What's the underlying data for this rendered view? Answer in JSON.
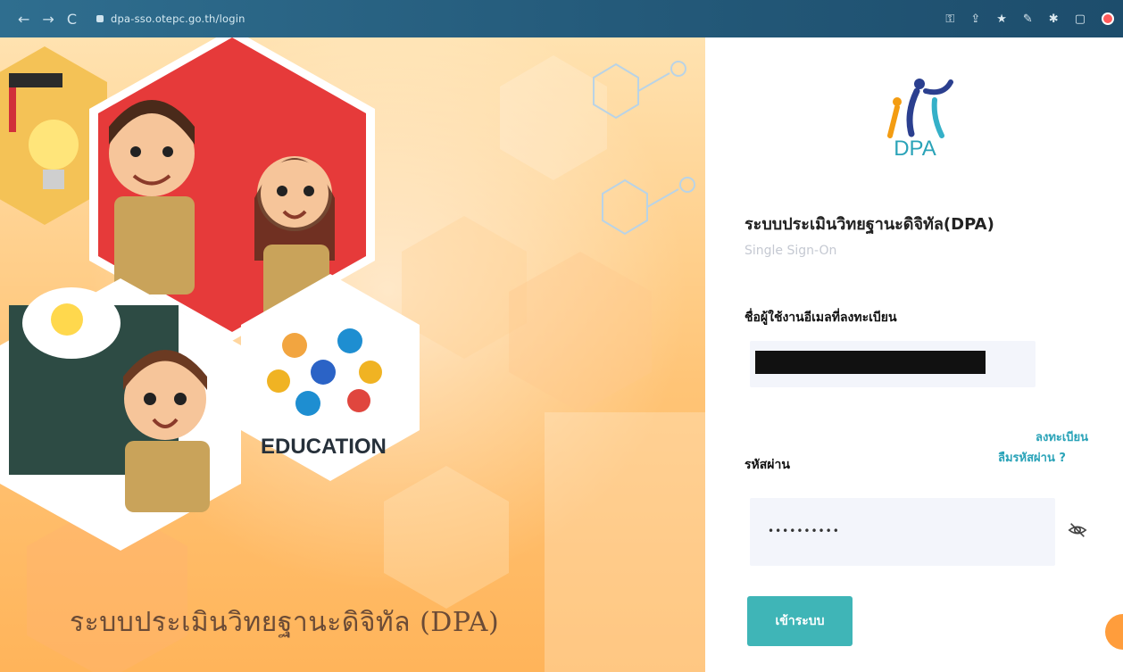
{
  "browser": {
    "url": "dpa-sso.otepc.go.th/login",
    "nav": [
      "←",
      "→",
      "C"
    ],
    "icons": [
      "key-icon",
      "share-icon",
      "star-icon",
      "extension-icon",
      "puzzle-icon",
      "sidebar-icon",
      "profile-icon"
    ]
  },
  "hero": {
    "title": "ระบบประเมินวิทยฐานะดิจิทัล (DPA)",
    "education_label": "EDUCATION"
  },
  "panel": {
    "logo_text": "DPA",
    "title": "ระบบประเมินวิทยฐานะดิจิทัล(DPA)",
    "subtitle": "Single Sign-On",
    "username_label": "ชื่อผู้ใช้งานอีเมลที่ลงทะเบียน",
    "register_link": "ลงทะเบียน",
    "forgot_link": "ลืมรหัสผ่าน ?",
    "password_label": "รหัสผ่าน",
    "password_value": "••••••••••",
    "login_button": "เข้าระบบ"
  },
  "colors": {
    "accent": "#3fb5b7",
    "link": "#2aa3b8",
    "chrome": "#2f6e8f"
  }
}
